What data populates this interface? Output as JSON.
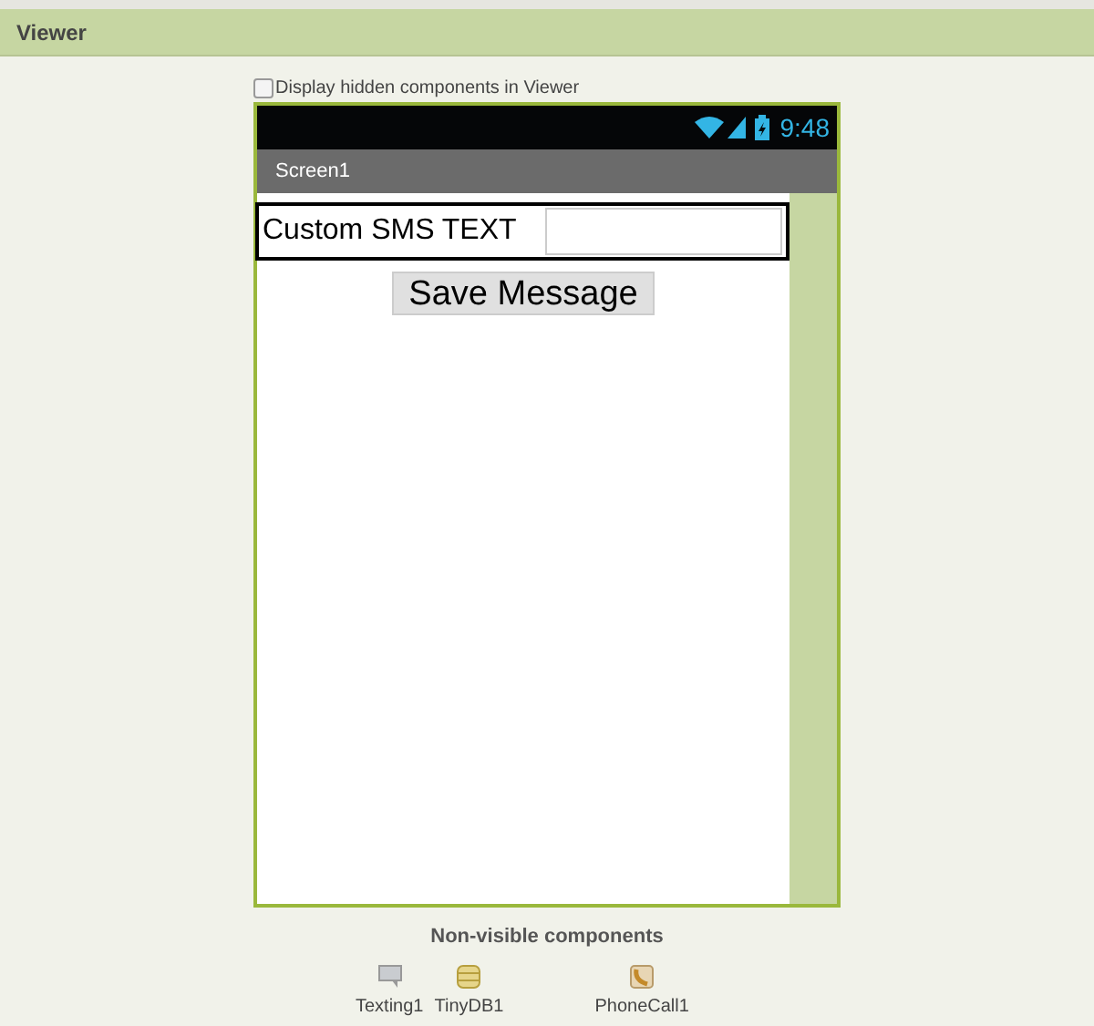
{
  "panel": {
    "title": "Viewer"
  },
  "hidden_toggle": {
    "label": "Display hidden components in Viewer",
    "checked": false
  },
  "phone": {
    "time": "9:48",
    "screen_title": "Screen1",
    "row": {
      "label": "Custom SMS TEXT"
    },
    "button": "Save Message"
  },
  "non_visible": {
    "title": "Non-visible components",
    "items": [
      {
        "kind": "texting",
        "label": "Texting1"
      },
      {
        "kind": "tinydb",
        "label": "TinyDB1"
      },
      {
        "kind": "phone",
        "label": "PhoneCall1"
      }
    ]
  }
}
